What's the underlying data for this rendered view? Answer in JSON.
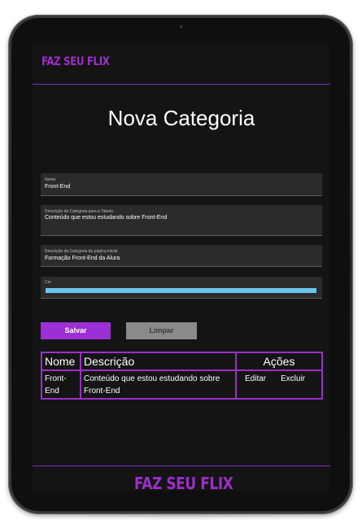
{
  "header": {
    "logo": "FAZ SEU FLIX"
  },
  "page": {
    "title": "Nova Categoria"
  },
  "form": {
    "name": {
      "label": "Nome",
      "value": "Front-End"
    },
    "table_description": {
      "label": "Descrição da Categoria para a Tabela",
      "value": "Conteúdo que estou estudando sobre Front-End"
    },
    "home_description": {
      "label": "Descrição da Categoria da página inicial",
      "value": "Formação Front-End da Alura"
    },
    "color": {
      "label": "Cor",
      "value": "#6bc6f2"
    },
    "save_label": "Salvar",
    "clear_label": "Limpar"
  },
  "table": {
    "headers": [
      "Nome",
      "Descrição",
      "Ações"
    ],
    "rows": [
      {
        "name": "Front-End",
        "description": "Conteúdo que estou estudando sobre Front-End",
        "edit": "Editar",
        "delete": "Excluir"
      }
    ]
  },
  "footer": {
    "logo": "FAZ SEU FLIX"
  },
  "colors": {
    "accent": "#9c2fc9",
    "background": "#141414",
    "field_bg": "#2b2b2b"
  }
}
